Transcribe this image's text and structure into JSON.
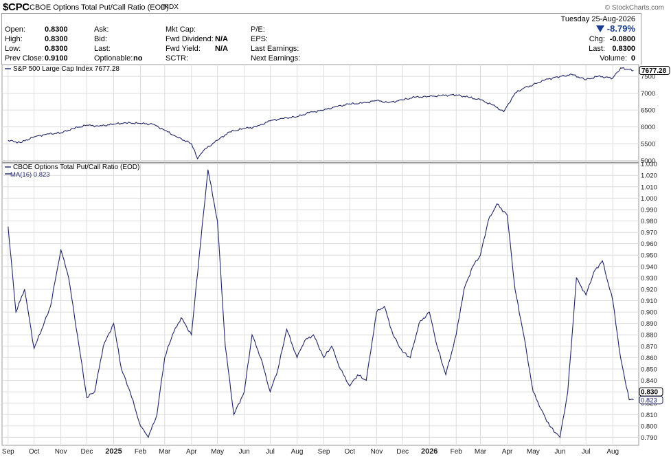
{
  "header": {
    "symbol": "$CPC",
    "name": "CBOE Options Total Put/Call Ratio (EOD)",
    "exchange": "INDX",
    "brand": "© StockCharts.com"
  },
  "quote": {
    "open_label": "Open:",
    "open": "0.8300",
    "high_label": "High:",
    "high": "0.8300",
    "low_label": "Low:",
    "low": "0.8300",
    "prev_close_label": "Prev Close:",
    "prev_close": "0.9100",
    "ask_label": "Ask:",
    "bid_label": "Bid:",
    "last_label": "Last:",
    "optionable_label": "Optionable:",
    "optionable": "no",
    "mkt_cap_label": "Mkt Cap:",
    "fwd_dividend_label": "Fwd Dividend:",
    "fwd_dividend": "N/A",
    "fwd_yield_label": "Fwd Yield:",
    "fwd_yield": "N/A",
    "sctr_label": "SCTR:",
    "pe_label": "P/E:",
    "eps_label": "EPS:",
    "last_earnings_label": "Last Earnings:",
    "next_earnings_label": "Next Earnings:",
    "date": "Tuesday  25-Aug-2026",
    "change_pct": "-8.79%",
    "chg_label": "Chg:",
    "chg": "-0.0800",
    "last_label_r": "Last:",
    "last": "0.8300",
    "volume_label": "Volume:",
    "volume": "0"
  },
  "colors": {
    "line": "#1e2466",
    "grid": "#dcdcdc",
    "border": "#9a9a9a"
  },
  "chart_data": [
    {
      "type": "line",
      "title": "S&P 500 Large Cap Index 7677.28",
      "series": [
        {
          "name": "S&P 500 Large Cap Index",
          "last": "7677.28",
          "x": [
            "2024-09-01",
            "2024-09-15",
            "2024-10-01",
            "2024-10-15",
            "2024-11-01",
            "2024-11-15",
            "2024-12-01",
            "2024-12-15",
            "2025-01-01",
            "2025-01-15",
            "2025-02-01",
            "2025-02-15",
            "2025-03-01",
            "2025-03-15",
            "2025-04-01",
            "2025-04-08",
            "2025-04-15",
            "2025-05-01",
            "2025-05-15",
            "2025-06-01",
            "2025-06-15",
            "2025-07-01",
            "2025-07-15",
            "2025-08-01",
            "2025-08-15",
            "2025-09-01",
            "2025-09-15",
            "2025-10-01",
            "2025-10-15",
            "2025-11-01",
            "2025-11-15",
            "2025-12-01",
            "2025-12-15",
            "2026-01-01",
            "2026-01-15",
            "2026-02-01",
            "2026-02-15",
            "2026-03-01",
            "2026-03-15",
            "2026-03-28",
            "2026-04-10",
            "2026-04-20",
            "2026-05-01",
            "2026-05-15",
            "2026-06-01",
            "2026-06-15",
            "2026-07-01",
            "2026-07-15",
            "2026-08-01",
            "2026-08-10",
            "2026-08-25"
          ],
          "values": [
            5600,
            5530,
            5700,
            5780,
            5820,
            5950,
            6050,
            6020,
            6080,
            6120,
            6100,
            6080,
            5900,
            5700,
            5500,
            5050,
            5300,
            5600,
            5850,
            5950,
            6000,
            6180,
            6250,
            6300,
            6420,
            6500,
            6600,
            6680,
            6700,
            6780,
            6720,
            6800,
            6880,
            6900,
            6930,
            6950,
            6880,
            6800,
            6650,
            6450,
            7000,
            7150,
            7250,
            7400,
            7500,
            7550,
            7400,
            7500,
            7450,
            7750,
            7677
          ]
        }
      ],
      "yticks": [
        "5000",
        "5500",
        "6000",
        "6500",
        "7000",
        "7500"
      ],
      "ylim": [
        4950,
        7850
      ]
    },
    {
      "type": "line",
      "title": "CBOE Options Total Put/Call Ratio (EOD)",
      "series": [
        {
          "name": "MA(16)",
          "last": "0.823",
          "x": [
            "2024-09-01",
            "2024-09-10",
            "2024-09-20",
            "2024-10-01",
            "2024-10-10",
            "2024-10-20",
            "2024-11-01",
            "2024-11-10",
            "2024-11-20",
            "2024-12-01",
            "2024-12-10",
            "2024-12-20",
            "2025-01-01",
            "2025-01-10",
            "2025-01-20",
            "2025-02-01",
            "2025-02-10",
            "2025-02-20",
            "2025-03-01",
            "2025-03-10",
            "2025-03-20",
            "2025-04-01",
            "2025-04-10",
            "2025-04-20",
            "2025-05-01",
            "2025-05-10",
            "2025-05-20",
            "2025-06-01",
            "2025-06-10",
            "2025-06-20",
            "2025-07-01",
            "2025-07-10",
            "2025-07-20",
            "2025-08-01",
            "2025-08-10",
            "2025-08-20",
            "2025-09-01",
            "2025-09-10",
            "2025-09-20",
            "2025-10-01",
            "2025-10-10",
            "2025-10-20",
            "2025-11-01",
            "2025-11-10",
            "2025-11-20",
            "2025-12-01",
            "2025-12-10",
            "2025-12-20",
            "2026-01-01",
            "2026-01-10",
            "2026-01-20",
            "2026-02-01",
            "2026-02-10",
            "2026-02-20",
            "2026-03-01",
            "2026-03-10",
            "2026-03-20",
            "2026-04-01",
            "2026-04-10",
            "2026-04-20",
            "2026-05-01",
            "2026-05-10",
            "2026-05-20",
            "2026-06-01",
            "2026-06-10",
            "2026-06-20",
            "2026-07-01",
            "2026-07-10",
            "2026-07-20",
            "2026-08-01",
            "2026-08-10",
            "2026-08-20",
            "2026-08-25"
          ],
          "values": [
            0.975,
            0.9,
            0.92,
            0.868,
            0.885,
            0.905,
            0.955,
            0.93,
            0.88,
            0.825,
            0.83,
            0.87,
            0.89,
            0.85,
            0.83,
            0.8,
            0.79,
            0.81,
            0.86,
            0.88,
            0.895,
            0.88,
            0.95,
            1.025,
            0.98,
            0.87,
            0.81,
            0.83,
            0.88,
            0.86,
            0.83,
            0.85,
            0.885,
            0.86,
            0.875,
            0.88,
            0.86,
            0.87,
            0.85,
            0.835,
            0.845,
            0.84,
            0.9,
            0.905,
            0.88,
            0.865,
            0.86,
            0.89,
            0.9,
            0.87,
            0.845,
            0.88,
            0.92,
            0.94,
            0.95,
            0.98,
            0.995,
            0.985,
            0.92,
            0.88,
            0.83,
            0.815,
            0.8,
            0.79,
            0.83,
            0.93,
            0.915,
            0.935,
            0.945,
            0.91,
            0.86,
            0.823,
            0.823
          ]
        }
      ],
      "yticks": [
        "0.790",
        "0.800",
        "0.810",
        "0.820",
        "0.830",
        "0.840",
        "0.850",
        "0.860",
        "0.870",
        "0.880",
        "0.890",
        "0.900",
        "0.910",
        "0.920",
        "0.930",
        "0.940",
        "0.950",
        "0.960",
        "0.970",
        "0.980",
        "0.990",
        "1.000",
        "1.010",
        "1.020",
        "1.030"
      ],
      "ylim": [
        0.783,
        1.031
      ],
      "last_label": "0.830"
    }
  ],
  "xaxis": {
    "labels": [
      "Sep",
      "Oct",
      "Nov",
      "Dec",
      "2025",
      "Feb",
      "Mar",
      "Apr",
      "May",
      "Jun",
      "Jul",
      "Aug",
      "Sep",
      "Oct",
      "Nov",
      "Dec",
      "2026",
      "Feb",
      "Mar",
      "Apr",
      "May",
      "Jun",
      "Jul",
      "Aug"
    ],
    "dates": [
      "2024-09-01",
      "2024-10-01",
      "2024-11-01",
      "2024-12-01",
      "2025-01-01",
      "2025-02-01",
      "2025-03-01",
      "2025-04-01",
      "2025-05-01",
      "2025-06-01",
      "2025-07-01",
      "2025-08-01",
      "2025-09-01",
      "2025-10-01",
      "2025-11-01",
      "2025-12-01",
      "2026-01-01",
      "2026-02-01",
      "2026-03-01",
      "2026-04-01",
      "2026-05-01",
      "2026-06-01",
      "2026-07-01",
      "2026-08-01"
    ],
    "start": "2024-08-25",
    "end": "2026-08-31"
  }
}
